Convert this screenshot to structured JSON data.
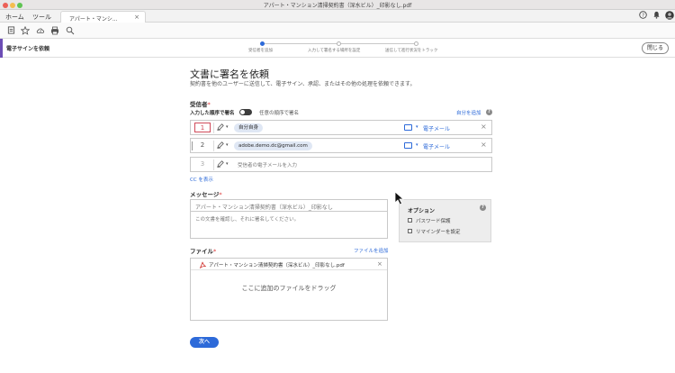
{
  "window": {
    "title": "アパート・マンション清掃契約書（深水ビル）_印影なし.pdf"
  },
  "menubar": {
    "home": "ホーム",
    "tools": "ツール"
  },
  "doc_tab": {
    "label": "アパート・マンシ...",
    "close": "×"
  },
  "stepbar": {
    "title": "電子サインを依頼",
    "steps": [
      {
        "label": "受信者を追加",
        "active": true
      },
      {
        "label": "入力して署名する場所を設定",
        "active": false
      },
      {
        "label": "送信して進行状況をトラック",
        "active": false
      }
    ],
    "close_label": "閉じる"
  },
  "form": {
    "heading": "文書に署名を依頼",
    "description": "契約書を他のユーザーに送信して、電子サイン、承認、またはその他の処理を依頼できます。",
    "recipients_label": "受信者",
    "required_mark": "*",
    "order_label": "入力した順序で署名",
    "any_order_label": "任意の順序で署名",
    "add_me_link": "自分を追加",
    "help": "?",
    "recipients": [
      {
        "number": "1",
        "value": "自分自身",
        "delivery": "電子メール",
        "remove": "×"
      },
      {
        "number": "2",
        "value": "adobe.demo.dc@gmail.com",
        "delivery": "電子メール",
        "remove": "×"
      },
      {
        "number": "3",
        "placeholder": "受信者の電子メールを入力"
      }
    ],
    "cc_link": "CC を表示",
    "message_label": "メッセージ",
    "message_title": "アパート・マンション清掃契約書（深水ビル）_印影なし",
    "message_body": "この文書を確認し、それに署名してください。",
    "files_label": "ファイル",
    "add_files_link": "ファイルを追加",
    "file_name": "アパート・マンション清掃契約書（深水ビル）_印影なし.pdf",
    "file_remove": "×",
    "drop_text": "ここに追加のファイルをドラッグ",
    "next_button": "次へ"
  },
  "options": {
    "title": "オプション",
    "help": "?",
    "items": [
      "パスワード保護",
      "リマインダーを設定"
    ]
  },
  "colors": {
    "accent": "#2d6ad9",
    "brand_bar": "#6c4db5",
    "selected_number": "#d04b5a"
  }
}
